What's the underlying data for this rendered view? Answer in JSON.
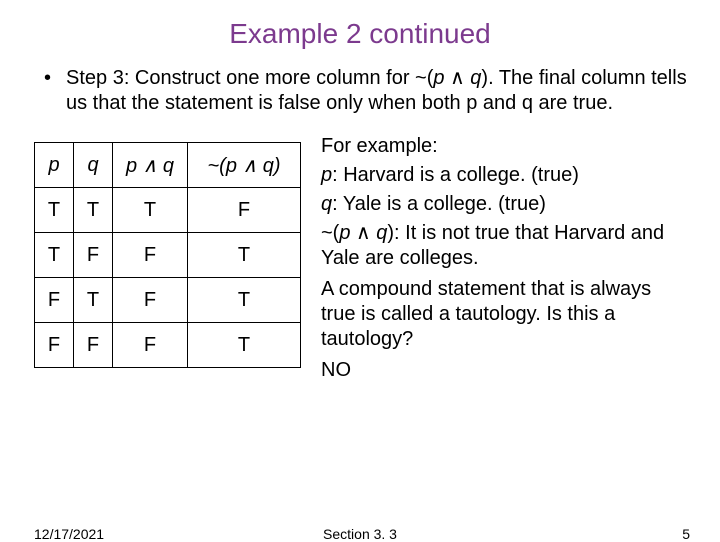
{
  "title": "Example 2 continued",
  "step_bullet": "•",
  "step_text_1": "Step 3:  Construct one more column for ~(",
  "step_p": "p",
  "step_and": " ∧ ",
  "step_q": "q",
  "step_text_2": ").  The final column tells us that the statement is false only when both p and q are true.",
  "table": {
    "headers": {
      "p": "p",
      "q": "q",
      "pq_p": "p",
      "pq_and": " ∧ ",
      "pq_q": "q",
      "npq_pre": "~(",
      "npq_p": "p",
      "npq_and": " ∧ ",
      "npq_q": "q",
      "npq_post": ")"
    },
    "rows": [
      {
        "p": "T",
        "q": "T",
        "pq": "T",
        "npq": "F"
      },
      {
        "p": "T",
        "q": "F",
        "pq": "F",
        "npq": "T"
      },
      {
        "p": "F",
        "q": "T",
        "pq": "F",
        "npq": "T"
      },
      {
        "p": "F",
        "q": "F",
        "pq": "F",
        "npq": "T"
      }
    ]
  },
  "example": {
    "intro": "For example:",
    "p_line_pre": " p",
    "p_line_post": ":  Harvard is a college. (true)",
    "q_line_pre": "q",
    "q_line_post": ":  Yale is a college. (true)",
    "neg_pre": "~(",
    "neg_p": "p",
    "neg_and": " ∧ ",
    "neg_q": "q",
    "neg_post": "):  It is not true that Harvard and Yale are colleges.",
    "taut": "A compound statement that is always true is called a tautology. Is this a tautology?",
    "answer": "NO"
  },
  "footer": {
    "date": "12/17/2021",
    "section": "Section 3. 3",
    "page": "5"
  }
}
